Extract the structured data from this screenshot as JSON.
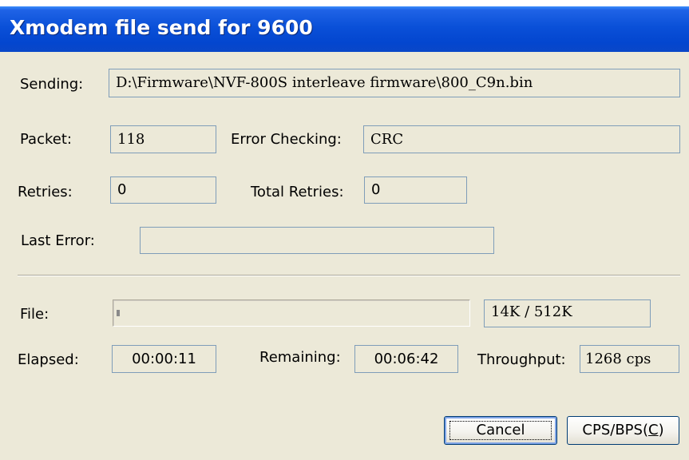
{
  "window": {
    "title": "Xmodem file send for 9600"
  },
  "sending": {
    "label": "Sending:",
    "value": "D:\\Firmware\\NVF-800S interleave firmware\\800_C9n.bin"
  },
  "packet": {
    "label": "Packet:",
    "value": "118"
  },
  "error_checking": {
    "label": "Error Checking:",
    "value": "CRC"
  },
  "retries": {
    "label": "Retries:",
    "value": "0"
  },
  "total_retries": {
    "label": "Total Retries:",
    "value": "0"
  },
  "last_error": {
    "label": "Last Error:",
    "value": ""
  },
  "file": {
    "label": "File:",
    "size_text": "14K / 512K",
    "progress_fraction": 0.0273
  },
  "elapsed": {
    "label": "Elapsed:",
    "value": "00:00:11"
  },
  "remaining": {
    "label": "Remaining:",
    "value": "00:06:42"
  },
  "throughput": {
    "label": "Throughput:",
    "value": "1268 cps"
  },
  "buttons": {
    "cancel": "Cancel",
    "cps_bps_prefix": "CPS/BPS(",
    "cps_bps_mnemonic": "C",
    "cps_bps_suffix": ")"
  },
  "colors": {
    "title_bar": "#0346cf",
    "dialog_bg": "#ece9d8",
    "field_border": "#7f9db9"
  }
}
